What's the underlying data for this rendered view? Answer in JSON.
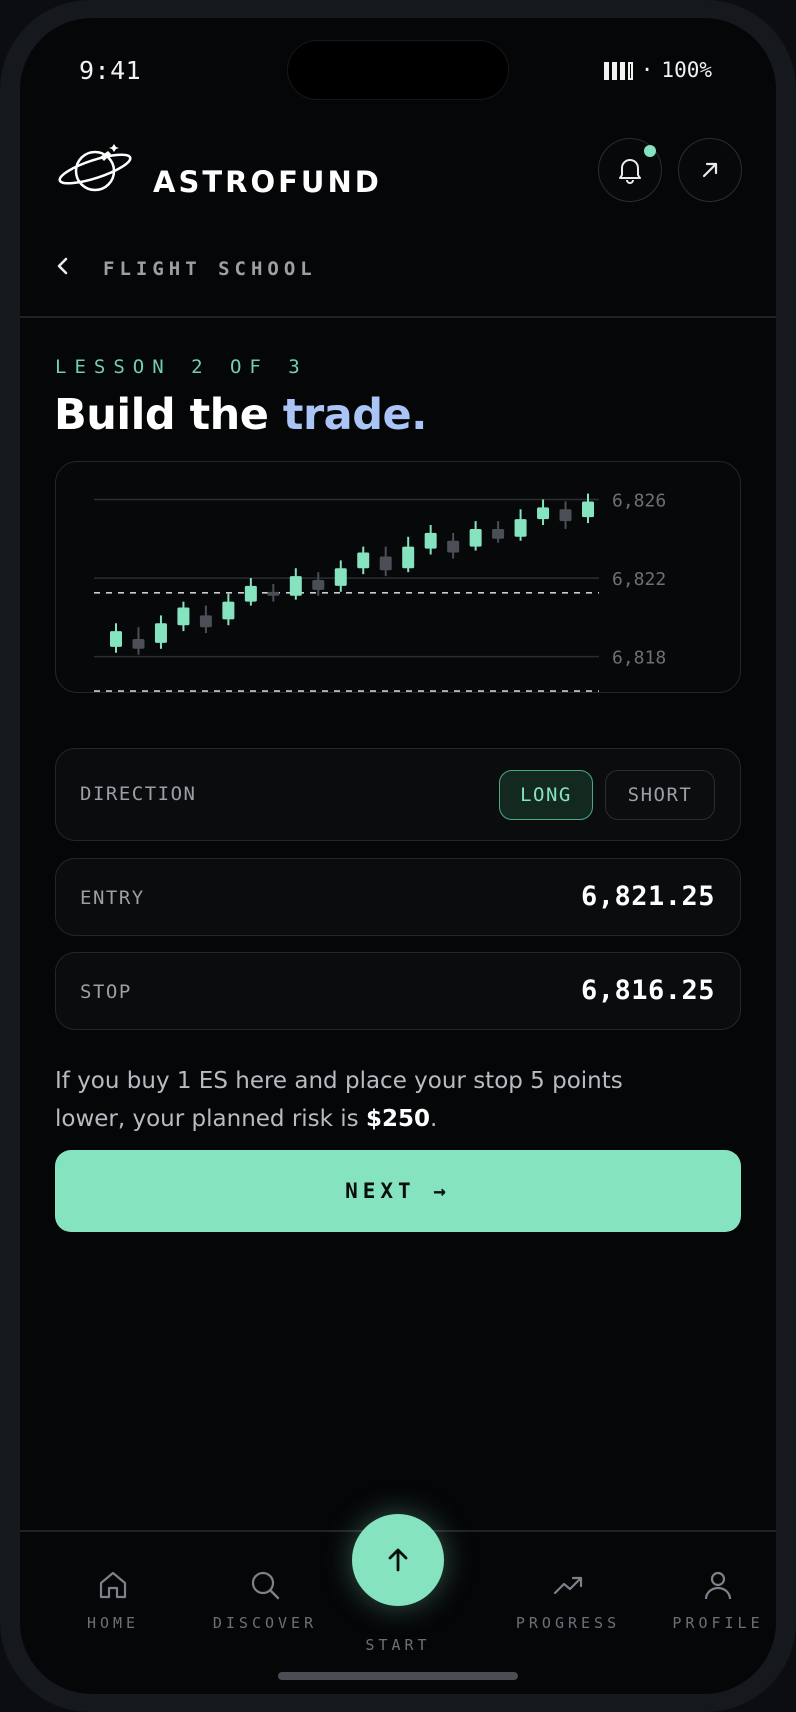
{
  "status": {
    "time": "9:41",
    "battery": "100%",
    "separator": "·"
  },
  "header": {
    "brand": "ASTROFUND"
  },
  "nav": {
    "section_title": "FLIGHT SCHOOL"
  },
  "lesson": {
    "progress_label": "LESSON 2 OF 3",
    "headline_plain": "Build the ",
    "headline_accent": "trade."
  },
  "chart_data": {
    "type": "candlestick",
    "y_ticks": [
      "6,826",
      "6,822",
      "6,818"
    ],
    "y_tick_values": [
      6826,
      6822,
      6818
    ],
    "ylim": [
      6816.1,
      6827.5
    ],
    "entry_level": 6821.25,
    "stop_level": 6816.25,
    "candles": [
      {
        "o": 6818.5,
        "c": 6819.3,
        "h": 6819.7,
        "l": 6818.2,
        "up": true
      },
      {
        "o": 6818.9,
        "c": 6818.4,
        "h": 6819.5,
        "l": 6818.1,
        "up": false
      },
      {
        "o": 6818.7,
        "c": 6819.7,
        "h": 6820.1,
        "l": 6818.4,
        "up": true
      },
      {
        "o": 6819.6,
        "c": 6820.5,
        "h": 6820.8,
        "l": 6819.3,
        "up": true
      },
      {
        "o": 6820.1,
        "c": 6819.5,
        "h": 6820.6,
        "l": 6819.2,
        "up": false
      },
      {
        "o": 6819.9,
        "c": 6820.8,
        "h": 6821.2,
        "l": 6819.6,
        "up": true
      },
      {
        "o": 6820.8,
        "c": 6821.6,
        "h": 6822.0,
        "l": 6820.6,
        "up": true
      },
      {
        "o": 6821.3,
        "c": 6821.1,
        "h": 6821.7,
        "l": 6820.8,
        "up": false
      },
      {
        "o": 6821.1,
        "c": 6822.1,
        "h": 6822.5,
        "l": 6820.9,
        "up": true
      },
      {
        "o": 6821.9,
        "c": 6821.4,
        "h": 6822.3,
        "l": 6821.1,
        "up": false
      },
      {
        "o": 6821.6,
        "c": 6822.5,
        "h": 6822.9,
        "l": 6821.3,
        "up": true
      },
      {
        "o": 6822.5,
        "c": 6823.3,
        "h": 6823.6,
        "l": 6822.2,
        "up": true
      },
      {
        "o": 6823.1,
        "c": 6822.4,
        "h": 6823.6,
        "l": 6822.1,
        "up": false
      },
      {
        "o": 6822.5,
        "c": 6823.6,
        "h": 6824.1,
        "l": 6822.3,
        "up": true
      },
      {
        "o": 6823.5,
        "c": 6824.3,
        "h": 6824.7,
        "l": 6823.2,
        "up": true
      },
      {
        "o": 6823.9,
        "c": 6823.3,
        "h": 6824.3,
        "l": 6823.0,
        "up": false
      },
      {
        "o": 6823.6,
        "c": 6824.5,
        "h": 6824.9,
        "l": 6823.4,
        "up": true
      },
      {
        "o": 6824.5,
        "c": 6824.0,
        "h": 6824.9,
        "l": 6823.8,
        "up": false
      },
      {
        "o": 6824.1,
        "c": 6825.0,
        "h": 6825.5,
        "l": 6823.9,
        "up": true
      },
      {
        "o": 6825.0,
        "c": 6825.6,
        "h": 6826.0,
        "l": 6824.7,
        "up": true
      },
      {
        "o": 6825.5,
        "c": 6824.9,
        "h": 6825.9,
        "l": 6824.5,
        "up": false
      },
      {
        "o": 6825.1,
        "c": 6825.9,
        "h": 6826.3,
        "l": 6824.8,
        "up": true
      }
    ],
    "colors": {
      "up": "#86e3c0",
      "down": "#4a4e56",
      "grid": "#2a2e33",
      "level": "#c9cdd2",
      "tick": "#6b7178"
    }
  },
  "direction": {
    "label": "DIRECTION",
    "long": "LONG",
    "short": "SHORT",
    "selected": "LONG"
  },
  "entry": {
    "label": "ENTRY",
    "value": "6,821.25"
  },
  "stop": {
    "label": "STOP",
    "value": "6,816.25"
  },
  "explanation": {
    "text_before": "If you buy 1 ES here and place your stop 5 points lower, your planned risk is ",
    "risk": "$250",
    "text_after": "."
  },
  "next_button": {
    "label": "NEXT →"
  },
  "tabs": {
    "home": "HOME",
    "discover": "DISCOVER",
    "start": "START",
    "progress": "PROGRESS",
    "profile": "PROFILE"
  },
  "theme": {
    "accent": "#86e3c0",
    "headline_accent": "#a9c4f5",
    "background": "#050608"
  }
}
